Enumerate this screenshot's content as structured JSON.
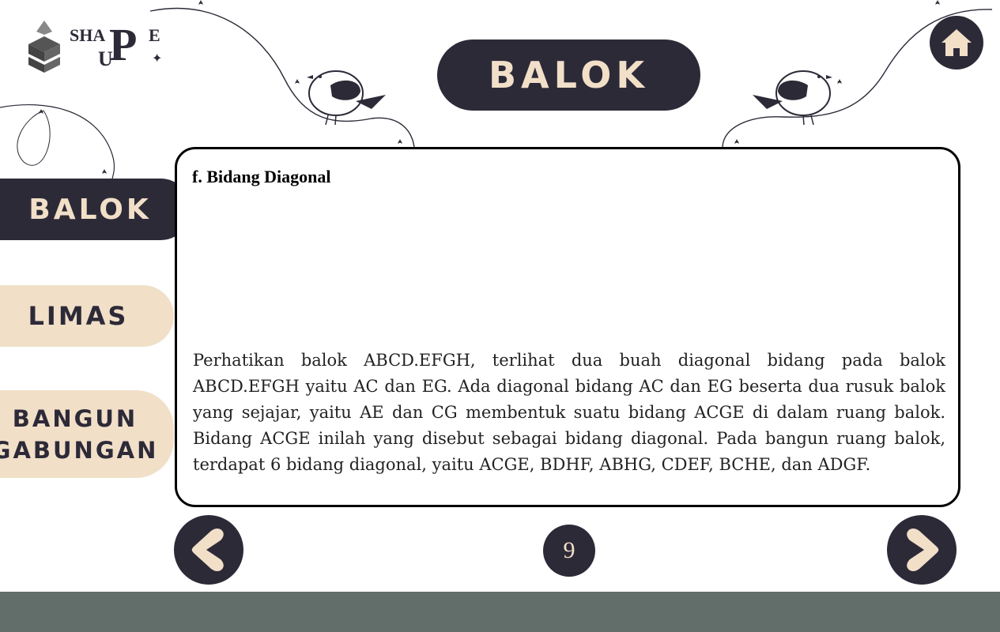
{
  "logo": {
    "line1": "SHA",
    "big_letter": "P",
    "line1_end": "E",
    "line2": "U"
  },
  "header": {
    "title": "BALOK"
  },
  "sidebar": {
    "items": [
      {
        "label": "BALOK",
        "active": true
      },
      {
        "label": "LIMAS",
        "active": false
      },
      {
        "label": "BANGUN\nGABUNGAN",
        "active": false
      }
    ]
  },
  "content": {
    "heading": "f. Bidang Diagonal",
    "paragraph": "Perhatikan balok ABCD.EFGH, terlihat dua buah diagonal bidang pada balok ABCD.EFGH yaitu AC dan EG. Ada diagonal bidang AC dan EG beserta dua rusuk balok yang sejajar, yaitu AE dan CG membentuk suatu bidang ACGE di dalam ruang balok. Bidang ACGE inilah yang disebut sebagai bidang diagonal. Pada bangun ruang balok, terdapat 6 bidang diagonal, yaitu ACGE, BDHF, ABHG, CDEF, BCHE, dan ADGF."
  },
  "pager": {
    "page_number": "9"
  },
  "icons": {
    "home": "home-icon",
    "prev": "arrow-left-icon",
    "next": "arrow-right-icon"
  },
  "colors": {
    "dark": "#2d2a38",
    "cream": "#f1dfc8",
    "footer": "#616e69"
  }
}
